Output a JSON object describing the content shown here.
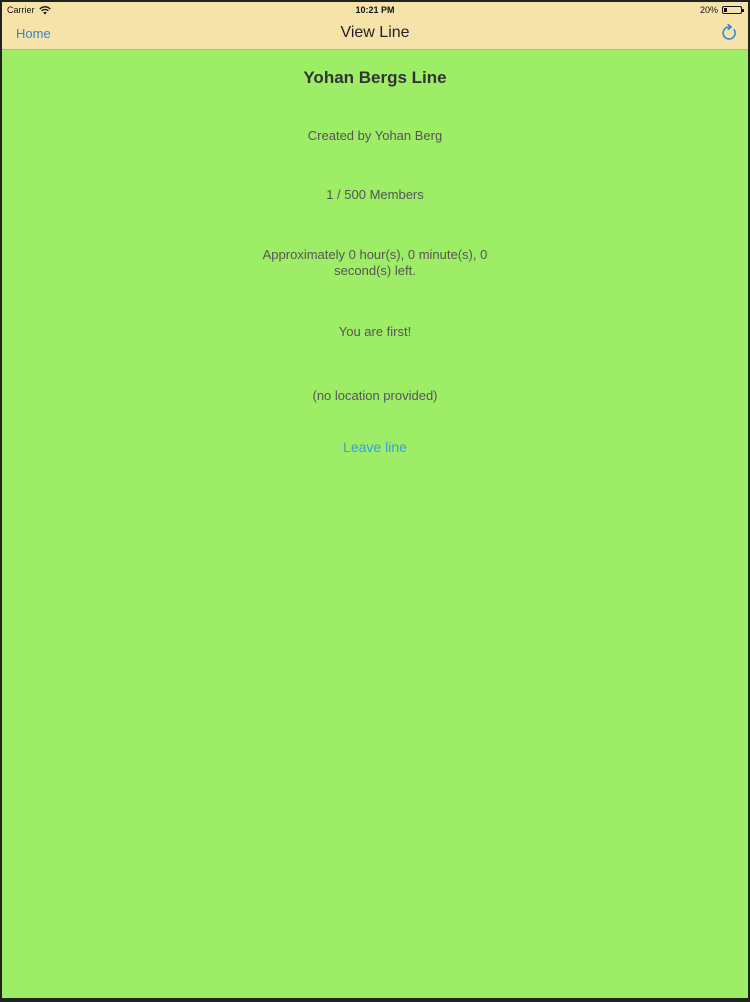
{
  "status_bar": {
    "carrier": "Carrier",
    "time": "10:21 PM",
    "battery_percent": "20%",
    "battery_level": 0.2,
    "icons": [
      "wifi-icon",
      "battery-icon"
    ]
  },
  "nav": {
    "back_label": "Home",
    "title": "View Line",
    "refresh_icon": "refresh-icon"
  },
  "line": {
    "title": "Yohan Bergs Line",
    "created_by": "Created by Yohan Berg",
    "members": "1 / 500 Members",
    "time_left": "Approximately 0 hour(s), 0 minute(s), 0 second(s) left.",
    "position": "You are first!",
    "location": "(no location provided)",
    "leave_label": "Leave line"
  },
  "colors": {
    "background": "#9ded66",
    "bar": "#f6e3aa",
    "accent": "#2f86d6"
  }
}
